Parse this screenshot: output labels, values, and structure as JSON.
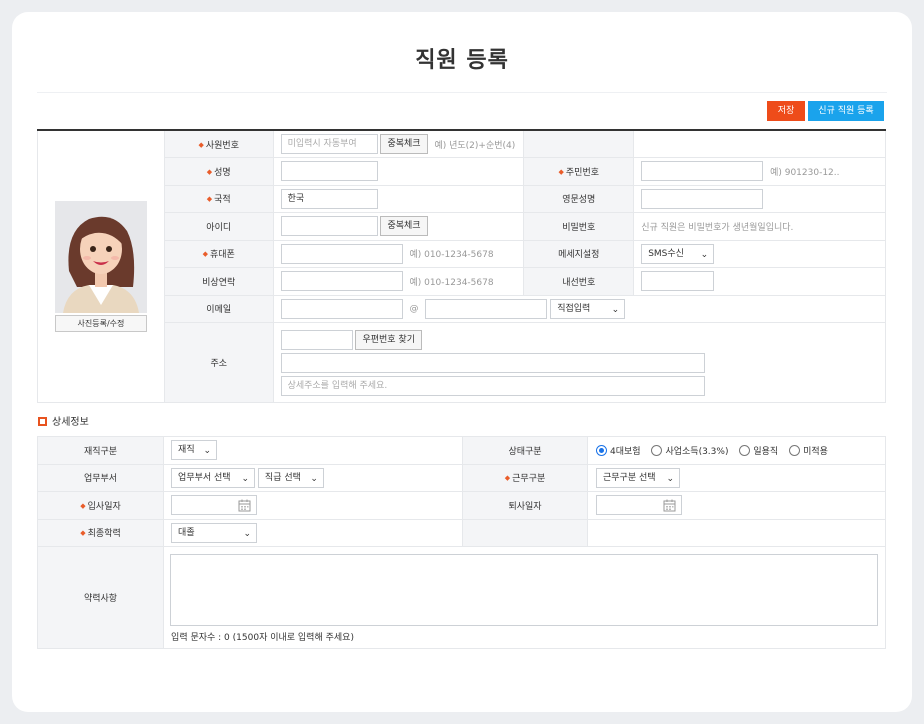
{
  "page": {
    "title": "직원 등록"
  },
  "toolbar": {
    "save_label": "저장",
    "new_label": "신규 직원 등록"
  },
  "photo": {
    "button_label": "사진등록/수정"
  },
  "basic": {
    "emp_no": {
      "label": "사원번호",
      "placeholder": "미입력시 자동부여",
      "check_button": "중복체크",
      "hint": "예) 년도(2)+순번(4)"
    },
    "name": {
      "label": "성명",
      "value": ""
    },
    "rrn": {
      "label": "주민번호",
      "hint": "예) 901230-12.."
    },
    "nationality": {
      "label": "국적",
      "value": "한국"
    },
    "eng_name": {
      "label": "영문성명",
      "value": ""
    },
    "user_id": {
      "label": "아이디",
      "check_button": "중복체크"
    },
    "password": {
      "label": "비밀번호",
      "note": "신규 직원은 비밀번호가 생년월일입니다."
    },
    "mobile": {
      "label": "휴대폰",
      "hint": "예) 010-1234-5678"
    },
    "msg_setting": {
      "label": "메세지설정",
      "selected": "SMS수신"
    },
    "emergency": {
      "label": "비상연락",
      "hint": "예) 010-1234-5678"
    },
    "extension": {
      "label": "내선번호"
    },
    "email": {
      "label": "이메일",
      "at": "@",
      "domain_select": "직접입력"
    },
    "address": {
      "label": "주소",
      "zip_button": "우편번호 찾기",
      "detail_placeholder": "상세주소를 입력해 주세요."
    }
  },
  "detail": {
    "section_title": "상세정보",
    "employment_type": {
      "label": "재직구분",
      "selected": "재직"
    },
    "status_type": {
      "label": "상태구분",
      "options": [
        "4대보험",
        "사업소득(3.3%)",
        "일용직",
        "미적용"
      ],
      "selected_index": 0
    },
    "department": {
      "label": "업무부서",
      "dept_select": "업무부서 선택",
      "rank_select": "직급 선택"
    },
    "work_type": {
      "label": "근무구분",
      "selected": "근무구분 선택"
    },
    "join_date": {
      "label": "입사일자"
    },
    "leave_date": {
      "label": "퇴사일자"
    },
    "education": {
      "label": "최종학력",
      "selected": "대졸"
    },
    "career": {
      "label": "약력사항",
      "counter": "입력 문자수 : 0 (1500자 이내로 입력해 주세요)"
    }
  },
  "colors": {
    "save": "#ee4c1a",
    "new": "#1aa3ec",
    "required": "#e95d2b",
    "radio_on": "#1a73e8"
  }
}
